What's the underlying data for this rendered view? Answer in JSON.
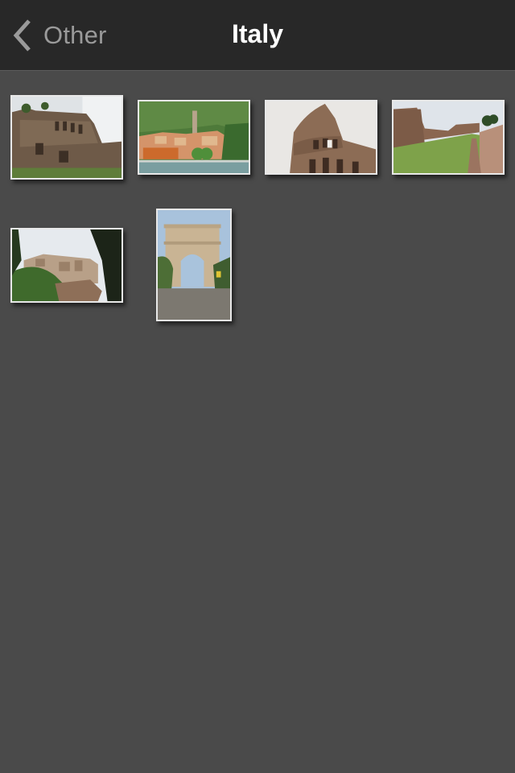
{
  "nav": {
    "back_label": "Other",
    "back_icon": "chevron-left-icon",
    "title": "Italy"
  },
  "colors": {
    "nav_bg": "#282828",
    "content_bg": "#4a4a4a",
    "back_text": "#9a9a9a",
    "title_text": "#ffffff",
    "thumb_border": "#e8e8e8"
  },
  "photos": [
    {
      "subject": "Palatine Hill ruins",
      "orientation": "landscape"
    },
    {
      "subject": "Lakeside village (Varenna)",
      "orientation": "landscape"
    },
    {
      "subject": "Colosseum",
      "orientation": "landscape"
    },
    {
      "subject": "Stadium of Domitian, Palatine",
      "orientation": "landscape"
    },
    {
      "subject": "View over Rome rooftops",
      "orientation": "landscape"
    },
    {
      "subject": "Arch of Titus",
      "orientation": "portrait"
    }
  ]
}
